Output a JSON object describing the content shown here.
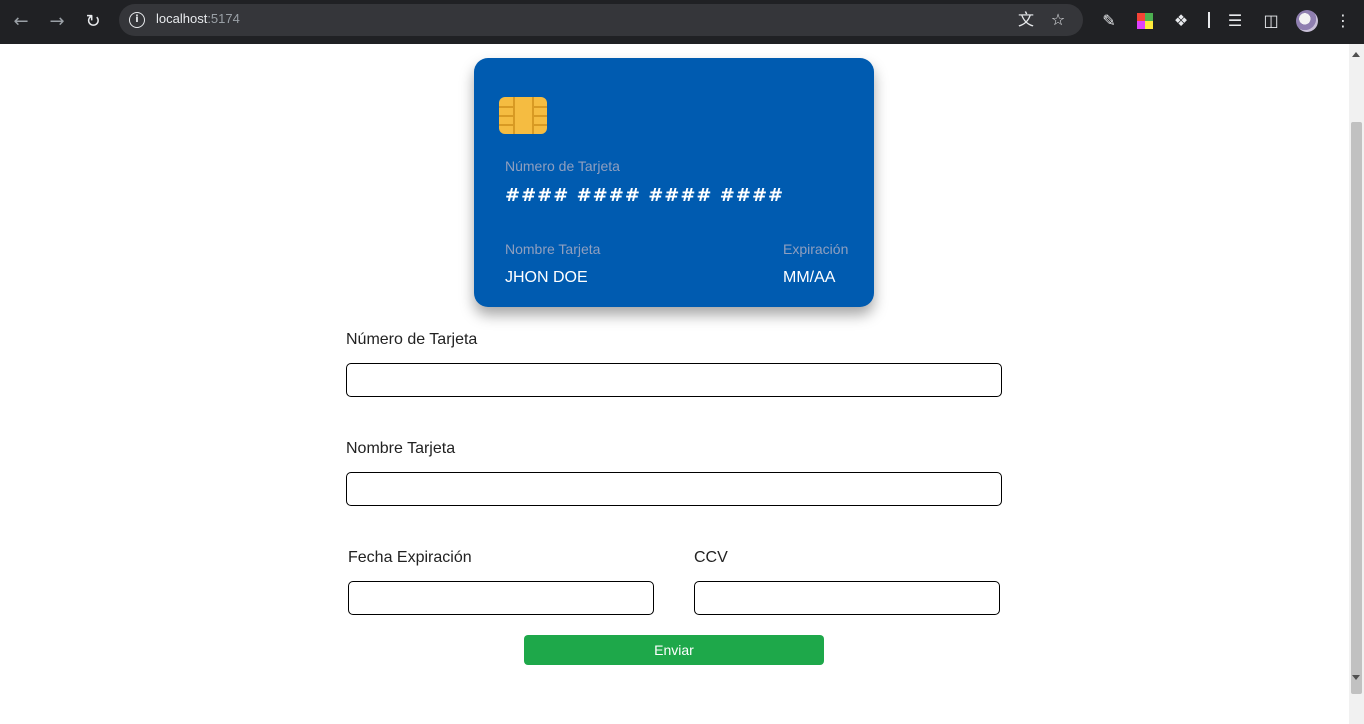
{
  "browser": {
    "url_host": "localhost",
    "url_port": ":5174"
  },
  "card": {
    "number_label": "Número de Tarjeta",
    "number_value": "#### #### #### ####",
    "name_label": "Nombre Tarjeta",
    "name_value": "JHON DOE",
    "expiry_label": "Expiración",
    "expiry_value": "MM/AA",
    "color": "#005bb0",
    "chip_color": "#f5bc41"
  },
  "form": {
    "number_label": "Número de Tarjeta",
    "number_value": "",
    "name_label": "Nombre Tarjeta",
    "name_value": "",
    "expiry_label": "Fecha Expiración",
    "expiry_value": "",
    "ccv_label": "CCV",
    "ccv_value": "",
    "submit_label": "Enviar",
    "submit_color": "#1ea84a"
  }
}
